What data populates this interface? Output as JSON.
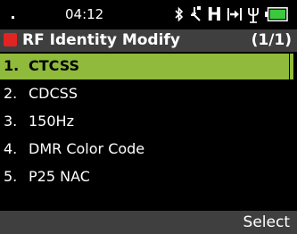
{
  "status_bar": {
    "time": "04:12",
    "icons": [
      "bluetooth-icon",
      "gps-icon",
      "h-mode-icon",
      "transfer-icon",
      "antenna-icon",
      "battery-icon"
    ],
    "h_text": "H",
    "battery_color": "#3cc83c"
  },
  "title_bar": {
    "title": "RF Identity Modify",
    "page": "(1/1)",
    "marker_color": "#e02424"
  },
  "menu": {
    "selected_index": 0,
    "highlight_color": "#8fba3c",
    "items": [
      {
        "num": "1.",
        "label": "CTCSS"
      },
      {
        "num": "2.",
        "label": "CDCSS"
      },
      {
        "num": "3.",
        "label": "150Hz"
      },
      {
        "num": "4.",
        "label": "DMR Color Code"
      },
      {
        "num": "5.",
        "label": "P25 NAC"
      }
    ]
  },
  "softkeys": {
    "left": "",
    "right": "Select"
  }
}
